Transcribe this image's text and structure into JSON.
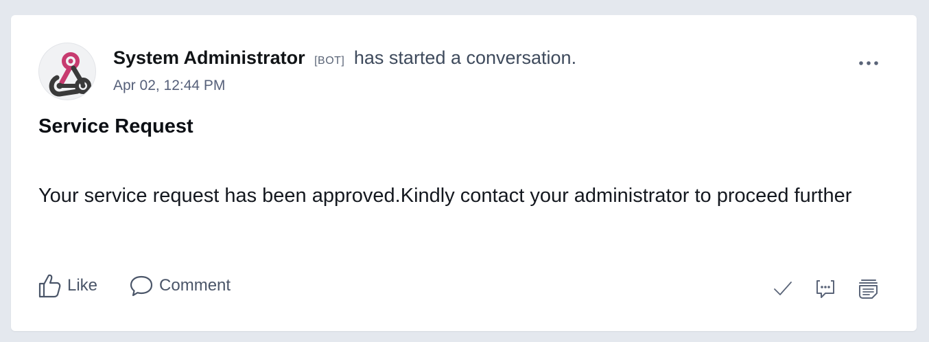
{
  "post": {
    "author": "System Administrator",
    "bot_tag": "[BOT]",
    "action_text": "has started a conversation.",
    "timestamp": "Apr 02, 12:44 PM",
    "title": "Service Request",
    "body": "Your service request has been approved.Kindly contact your administrator to proceed further"
  },
  "actions": {
    "like_label": "Like",
    "comment_label": "Comment"
  },
  "icons": {
    "avatar": "webhook-logo-icon",
    "more": "more-horizontal-icon",
    "like": "thumbs-up-icon",
    "comment": "comment-bubble-icon",
    "mark_done": "checkmark-icon",
    "reply": "chat-dots-icon",
    "notes": "stacked-notes-icon"
  },
  "colors": {
    "accent_pink": "#c73b6f",
    "logo_dark": "#3a3a3a",
    "icon_gray": "#5a6478"
  }
}
